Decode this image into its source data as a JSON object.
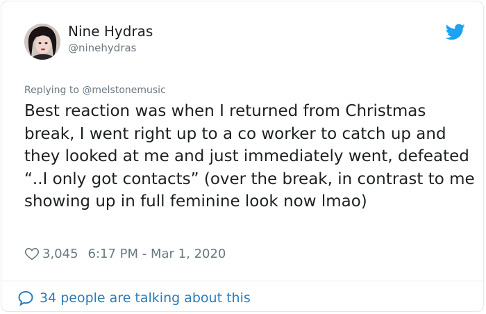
{
  "user": {
    "display_name": "Nine Hydras",
    "handle": "@ninehydras",
    "avatar_icon": "profile-photo"
  },
  "brand": {
    "logo_icon": "twitter-bird-icon",
    "accent_color": "#1da1f2"
  },
  "reply": {
    "prefix": "Replying to ",
    "mention": "@melstonemusic"
  },
  "tweet": {
    "text": "Best reaction was when I returned from Christmas break, I went right up to a co worker to catch up and they looked at me and just immediately went, defeated “..I only got contacts” (over the break, in contrast to me showing up in full feminine look now lmao)"
  },
  "meta": {
    "likes": "3,045",
    "timestamp": "6:17 PM - Mar 1, 2020"
  },
  "footer": {
    "talking_text": "34 people are talking about this",
    "link_color": "#2b7bb9"
  }
}
